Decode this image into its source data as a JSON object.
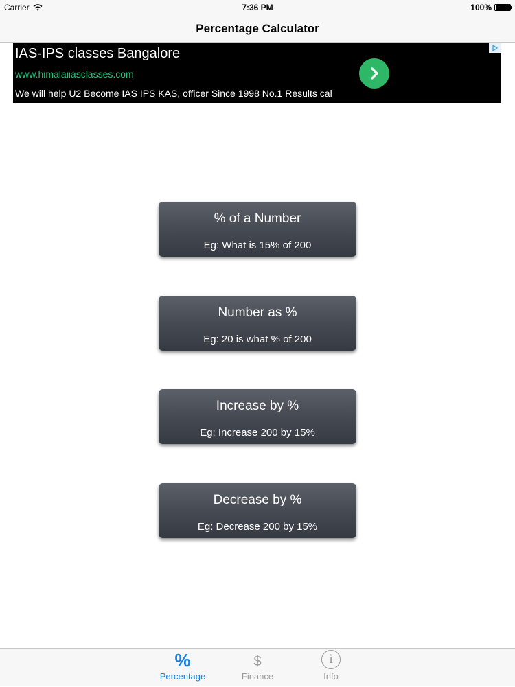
{
  "status_bar": {
    "carrier": "Carrier",
    "time": "7:36 PM",
    "battery": "100%"
  },
  "nav": {
    "title": "Percentage Calculator"
  },
  "ad": {
    "title": "IAS-IPS classes Bangalore",
    "url": "www.himalaiiasclasses.com",
    "description": "We will help U2 Become IAS IPS KAS, officer Since 1998 No.1 Results cal",
    "arrow_color": "#2fb768"
  },
  "buttons": [
    {
      "label": "% of a Number",
      "example": "Eg: What is 15% of 200"
    },
    {
      "label": "Number as %",
      "example": "Eg: 20 is what % of 200"
    },
    {
      "label": "Increase by %",
      "example": "Eg: Increase 200 by 15%"
    },
    {
      "label": "Decrease by %",
      "example": "Eg: Decrease 200 by 15%"
    }
  ],
  "tabs": [
    {
      "label": "Percentage",
      "icon": "percent-icon",
      "glyph": "%",
      "selected": true
    },
    {
      "label": "Finance",
      "icon": "dollar-icon",
      "glyph": "$",
      "selected": false
    },
    {
      "label": "Info",
      "icon": "info-icon",
      "glyph": "i",
      "selected": false
    }
  ],
  "colors": {
    "accent": "#1a82e3",
    "inactive": "#9a9a9a",
    "button_dark": "#464a53"
  }
}
